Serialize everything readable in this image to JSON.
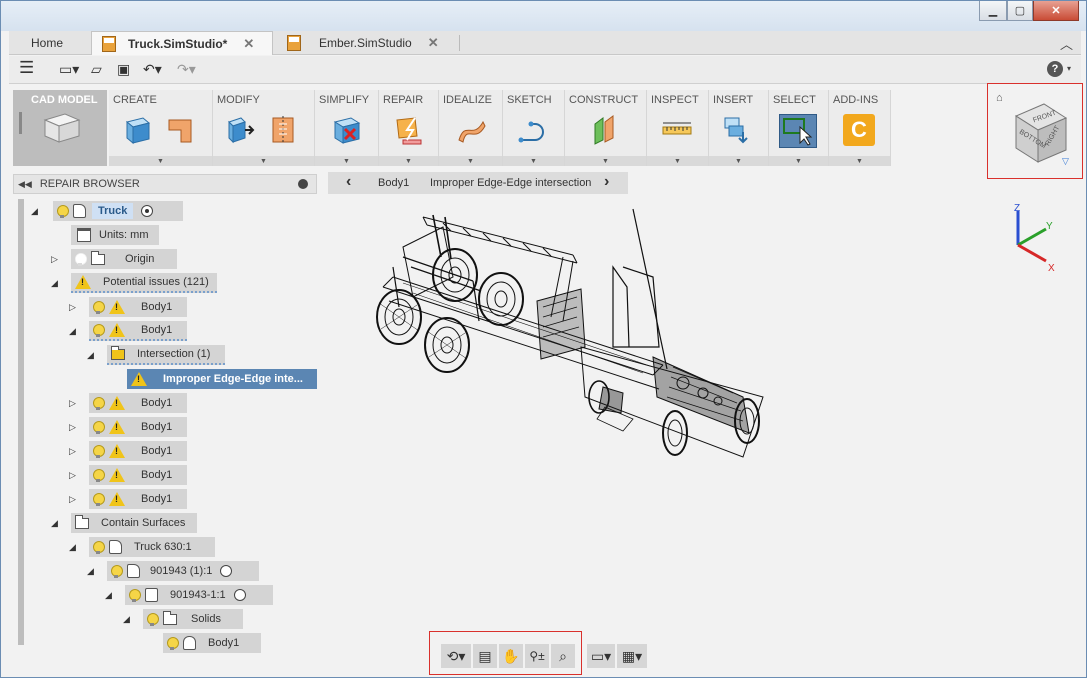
{
  "tabs": {
    "home": "Home",
    "truck": "Truck.SimStudio*",
    "ember": "Ember.SimStudio",
    "close_glyph": "✕"
  },
  "ribbon": {
    "cad_model": "CAD MODEL",
    "groups": [
      "CREATE",
      "MODIFY",
      "SIMPLIFY",
      "REPAIR",
      "IDEALIZE",
      "SKETCH",
      "CONSTRUCT",
      "INSPECT",
      "INSERT",
      "SELECT",
      "ADD-INS"
    ]
  },
  "browser": {
    "title": "REPAIR BROWSER"
  },
  "breadcrumb": {
    "body": "Body1",
    "issue": "Improper Edge-Edge intersection"
  },
  "tree": {
    "root": "Truck",
    "units": "Units: mm",
    "origin": "Origin",
    "potential": "Potential issues (121)",
    "body1": "Body1",
    "intersection": "Intersection (1)",
    "improper": "Improper Edge-Edge inte...",
    "contain": "Contain Surfaces",
    "truck630": "Truck 630:1",
    "n901943": "901943 (1):1",
    "n901943b": "901943-1:1",
    "solids": "Solids"
  },
  "viewcube": {
    "front": "FRONT",
    "right": "RIGHT",
    "bottom": "BOTTOM"
  },
  "triad": {
    "x": "X",
    "y": "Y",
    "z": "Z"
  },
  "colors": {
    "accent_blue": "#5b86b3",
    "highlight_red": "#d9302c",
    "warning": "#f0c419"
  }
}
